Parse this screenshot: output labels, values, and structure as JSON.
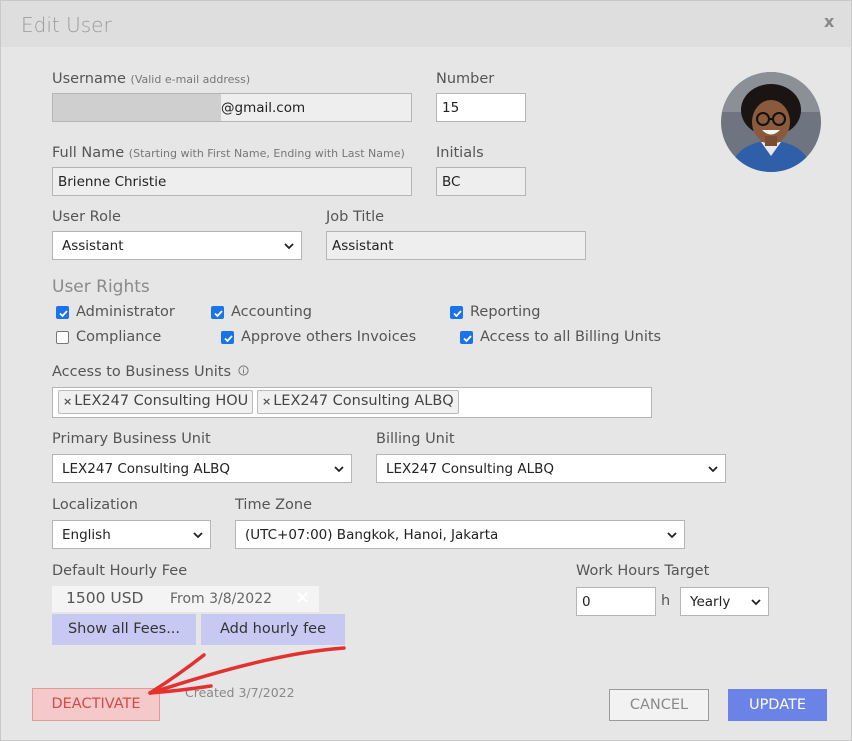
{
  "dialog": {
    "title": "Edit User",
    "close_label": "x"
  },
  "fields": {
    "username": {
      "label": "Username",
      "hint": "(Valid e-mail address)",
      "value": "@gmail.com"
    },
    "number": {
      "label": "Number",
      "value": "15"
    },
    "full_name": {
      "label": "Full Name",
      "hint": "(Starting with First Name, Ending with Last Name)",
      "value": "Brienne Christie"
    },
    "initials": {
      "label": "Initials",
      "value": "BC"
    },
    "user_role": {
      "label": "User Role",
      "value": "Assistant"
    },
    "job_title": {
      "label": "Job Title",
      "value": "Assistant"
    }
  },
  "user_rights": {
    "heading": "User Rights",
    "items": [
      {
        "label": "Administrator",
        "checked": true
      },
      {
        "label": "Accounting",
        "checked": true
      },
      {
        "label": "Reporting",
        "checked": true
      },
      {
        "label": "Compliance",
        "checked": false
      },
      {
        "label": "Approve others Invoices",
        "checked": true
      },
      {
        "label": "Access to all Billing Units",
        "checked": true
      }
    ]
  },
  "business_units": {
    "label": "Access to Business Units",
    "info_icon": "info-icon",
    "tags": [
      "LEX247 Consulting HOU",
      "LEX247 Consulting ALBQ"
    ]
  },
  "primary_business_unit": {
    "label": "Primary Business Unit",
    "value": "LEX247 Consulting ALBQ"
  },
  "billing_unit": {
    "label": "Billing Unit",
    "value": "LEX247 Consulting ALBQ"
  },
  "localization": {
    "label": "Localization",
    "value": "English"
  },
  "time_zone": {
    "label": "Time Zone",
    "value": "(UTC+07:00) Bangkok, Hanoi, Jakarta"
  },
  "hourly_fee": {
    "label": "Default Hourly Fee",
    "amount": "1500 USD",
    "from": "From 3/8/2022",
    "remove_label": "×",
    "show_all_label": "Show all Fees...",
    "add_label": "Add hourly fee"
  },
  "work_hours": {
    "label": "Work Hours Target",
    "value": "0",
    "unit": "h",
    "period": "Yearly"
  },
  "footer": {
    "deactivate_label": "DEACTIVATE",
    "created": "Created 3/7/2022",
    "cancel_label": "CANCEL",
    "update_label": "UPDATE"
  },
  "colors": {
    "update_button": "#6b82e6",
    "deactivate_button": "#f5c9c9",
    "secondary_button": "#c7c9f2",
    "annotation_arrow": "#e53030",
    "checkbox": "#1a73e8"
  }
}
